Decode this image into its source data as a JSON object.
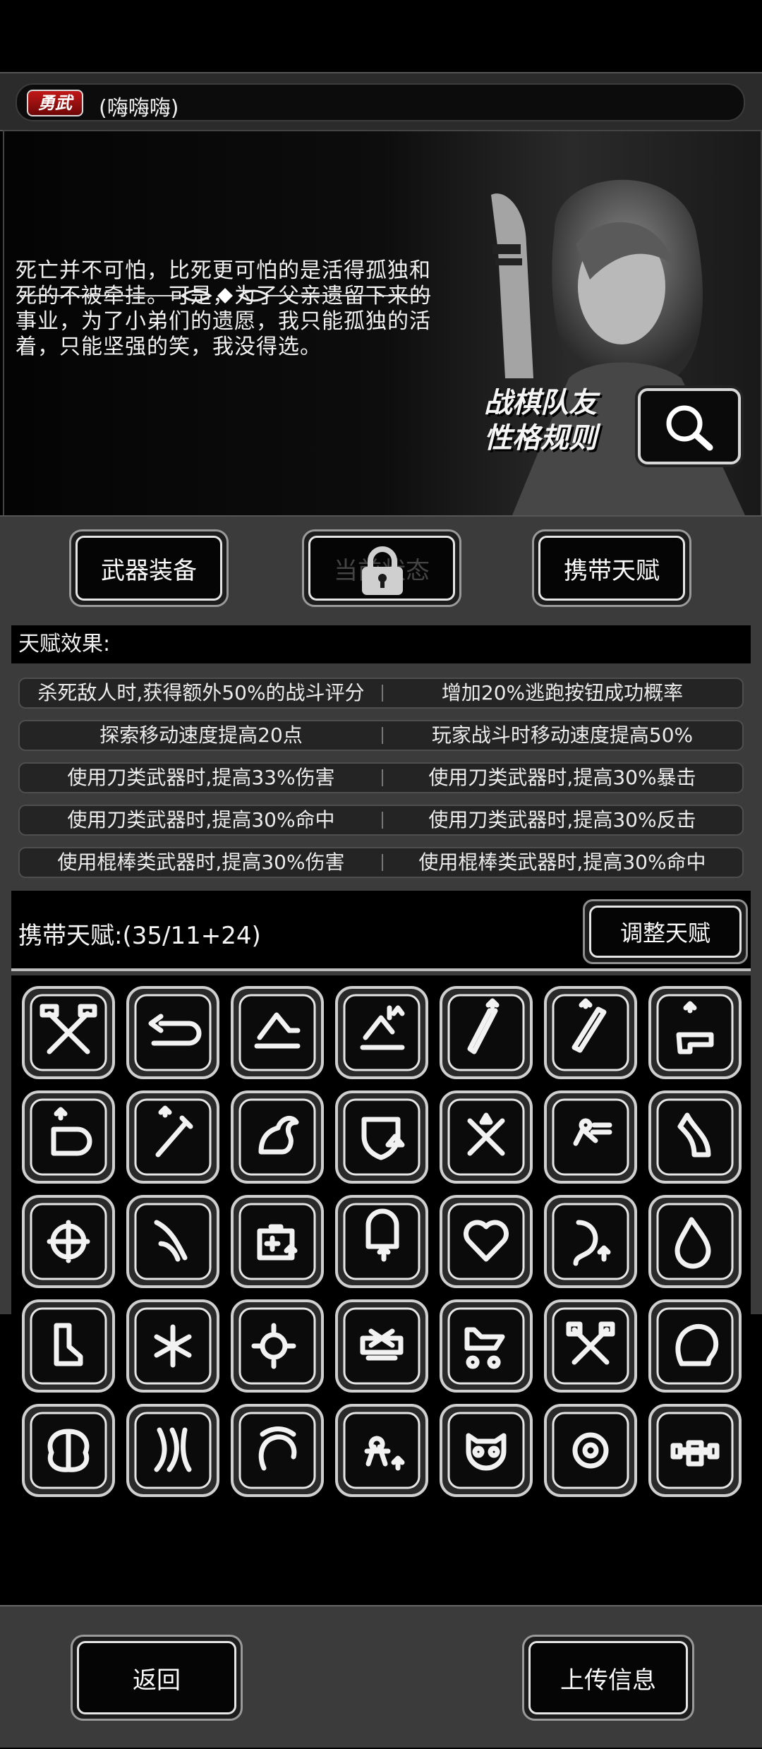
{
  "header": {
    "badge": "勇武",
    "name": "(嗨嗨嗨)"
  },
  "story": {
    "quote": "死亡并不可怕，比死更可怕的是活得孤独和死的不被牵挂。可是，为了父亲遗留下来的事业，为了小弟们的遗愿，我只能孤独的活着，只能坚强的笑，我没得选。",
    "rules_line1": "战棋队友",
    "rules_line2": "性格规则"
  },
  "tabs": {
    "weapons": "武器装备",
    "state": "当前状态",
    "talent": "携带天赋"
  },
  "effects": {
    "title": "天赋效果:",
    "rows": [
      [
        "杀死敌人时,获得额外50%的战斗评分",
        "增加20%逃跑按钮成功概率"
      ],
      [
        "探索移动速度提高20点",
        "玩家战斗时移动速度提高50%"
      ],
      [
        "使用刀类武器时,提高33%伤害",
        "使用刀类武器时,提高30%暴击"
      ],
      [
        "使用刀类武器时,提高30%命中",
        "使用刀类武器时,提高30%反击"
      ],
      [
        "使用棍棒类武器时,提高30%伤害",
        "使用棍棒类武器时,提高30%命中"
      ]
    ]
  },
  "carry": {
    "label": "携带天赋:(35/11+24)",
    "adjust": "调整天赋"
  },
  "talent_icons": [
    "crossed-axes-icon",
    "return-arrow-icon",
    "fast-shoe-icon",
    "speed-boot-icon",
    "knife-up-icon",
    "club-up-icon",
    "gun-up-icon",
    "fist-up-icon",
    "syringe-up-icon",
    "flexed-arm-icon",
    "shield-up-icon",
    "crossed-swords-icon",
    "running-man-icon",
    "leg-icon",
    "target-up-icon",
    "claw-arm-icon",
    "medkit-up-icon",
    "armor-up-icon",
    "heart-up-icon",
    "stomach-up-icon",
    "blood-drop-up-icon",
    "boot-up-icon",
    "snowflake-up-icon",
    "sun-up-icon",
    "repair-up-icon",
    "car-speed-icon",
    "crossed-hammers-icon",
    "head-brain-icon",
    "brain-icon",
    "nerves-icon",
    "dizzy-head-icon",
    "angry-person-icon",
    "owl-icon",
    "night-eye-icon",
    "dumbbell-hand-icon"
  ],
  "bottom": {
    "back": "返回",
    "upload": "上传信息"
  }
}
